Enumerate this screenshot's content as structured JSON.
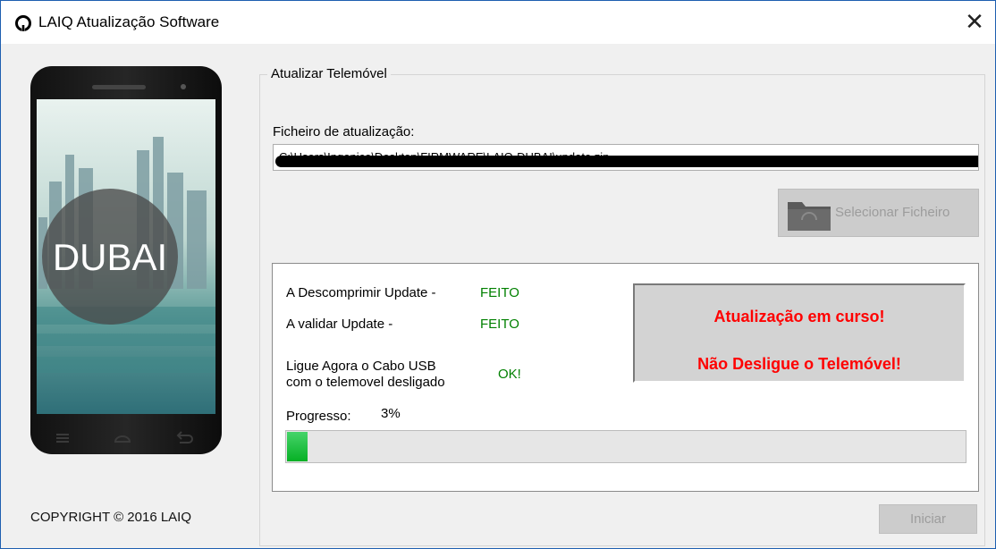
{
  "window": {
    "title": "LAIQ Atualização Software",
    "close_glyph": "✕"
  },
  "sidebar": {
    "phone_brand_text": "DUBAI",
    "copyright": "COPYRIGHT © 2016 LAIQ"
  },
  "group": {
    "title": "Atualizar Telemóvel"
  },
  "file": {
    "label": "Ficheiro de atualização:",
    "value": "C:\\Users\\Ingenico\\Desktop\\FIRMWARE\\LAIQ-DUBAI\\update.zip",
    "select_button_label": "Selecionar Ficheiro",
    "select_button_icon": "folder-icon"
  },
  "steps": [
    {
      "label": "A Descomprimir Update -",
      "status": "FEITO"
    },
    {
      "label": "A validar Update -",
      "status": "FEITO"
    },
    {
      "label_line1": "Ligue Agora o Cabo USB",
      "label_line2": "com o telemovel desligado",
      "status": "OK!"
    }
  ],
  "warning": {
    "line1": "Atualização em curso!",
    "line2": "Não Desligue o Telemóvel!"
  },
  "progress": {
    "label": "Progresso:",
    "value_text": "3%",
    "fraction": 0.03
  },
  "start_button_label": "Iniciar",
  "colors": {
    "status_ok": "#008000",
    "warning_text": "#ff0000",
    "progress_fill": "#06b025"
  }
}
